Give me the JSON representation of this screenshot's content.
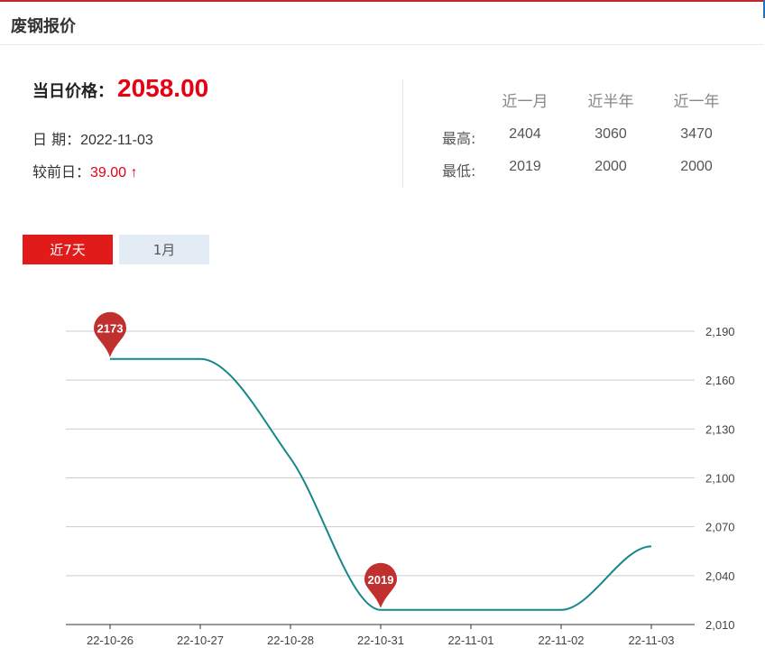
{
  "header": {
    "title": "废钢报价"
  },
  "price": {
    "label": "当日价格：",
    "value": "2058.00",
    "date_label": "日 期：",
    "date_value": "2022-11-03",
    "change_label": "较前日：",
    "change_value": "39.00 ↑"
  },
  "stats": {
    "columns": [
      "近一月",
      "近半年",
      "近一年"
    ],
    "rows": [
      {
        "label": "最高:",
        "values": [
          "2404",
          "3060",
          "3470"
        ]
      },
      {
        "label": "最低:",
        "values": [
          "2019",
          "2000",
          "2000"
        ]
      }
    ]
  },
  "tabs": [
    {
      "label": "近7天",
      "active": true
    },
    {
      "label": "1月",
      "active": false
    }
  ],
  "colors": {
    "accent": "#e11a1a",
    "line": "#16888a",
    "pin": "#c0302e"
  },
  "chart_data": {
    "type": "line",
    "categories": [
      "22-10-26",
      "22-10-27",
      "22-10-28",
      "22-10-31",
      "22-11-01",
      "22-11-02",
      "22-11-03"
    ],
    "values": [
      2173,
      2173,
      2112,
      2019,
      2019,
      2019,
      2058
    ],
    "y_ticks": [
      "2,010",
      "2,040",
      "2,070",
      "2,100",
      "2,130",
      "2,160",
      "2,190"
    ],
    "ylim": [
      2010,
      2190
    ],
    "grid": true,
    "markers": [
      {
        "label": "2173",
        "index": 0
      },
      {
        "label": "2019",
        "index": 3
      }
    ]
  }
}
